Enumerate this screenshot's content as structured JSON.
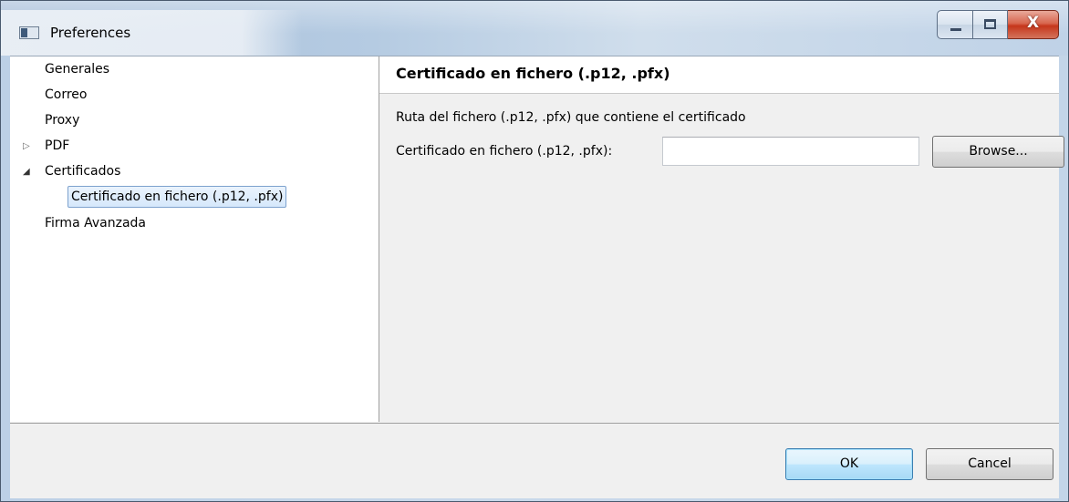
{
  "window": {
    "title": "Preferences",
    "controls": {
      "minimize": "",
      "maximize": "",
      "close": "X"
    }
  },
  "tree": {
    "items": [
      {
        "label": "Generales",
        "expander": ""
      },
      {
        "label": "Correo",
        "expander": ""
      },
      {
        "label": "Proxy",
        "expander": ""
      },
      {
        "label": "PDF",
        "expander": "collapsed"
      },
      {
        "label": "Certificados",
        "expander": "expanded"
      },
      {
        "label": "Certificado en fichero (.p12, .pfx)",
        "expander": "",
        "selected": true
      },
      {
        "label": "Firma Avanzada",
        "expander": ""
      }
    ]
  },
  "page": {
    "title": "Certificado en fichero (.p12, .pfx)",
    "description": "Ruta del fichero (.p12, .pfx) que contiene el certificado",
    "field_label": "Certificado en fichero (.p12, .pfx):",
    "field_value": "",
    "browse_label": "Browse..."
  },
  "footer": {
    "ok_label": "OK",
    "cancel_label": "Cancel"
  },
  "colors": {
    "selection_border": "#7da2ce",
    "default_button_border": "#3c7fb1",
    "close_button": "#c5361b"
  },
  "icons": {
    "app": "window-app-icon",
    "collapsed": "triangle-right-outline",
    "expanded": "triangle-down-filled"
  }
}
